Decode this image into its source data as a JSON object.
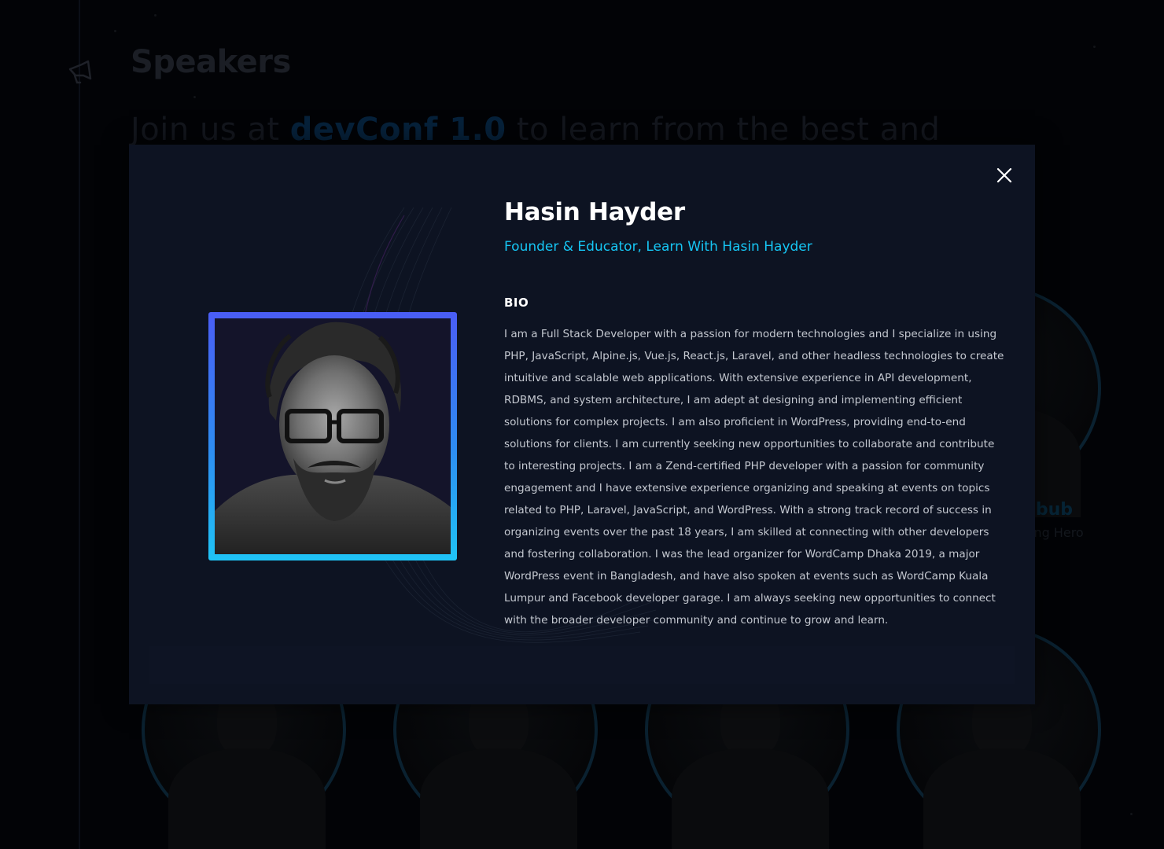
{
  "page": {
    "section_title": "Speakers",
    "headline_prefix": "Join us at ",
    "headline_highlight": "devConf 1.0",
    "headline_suffix": " to learn from the best and",
    "icons": {
      "section": "megaphone-icon",
      "close": "close-icon"
    }
  },
  "background_speaker": {
    "name_fragment": "abub",
    "role_fragment": "ing Hero"
  },
  "modal": {
    "name": "Hasin Hayder",
    "role": "Founder & Educator, Learn With Hasin Hayder",
    "bio_heading": "BIO",
    "bio": "I am a Full Stack Developer with a passion for modern technologies and I specialize in using PHP, JavaScript, Alpine.js, Vue.js, React.js, Laravel, and other headless technologies to create intuitive and scalable web applications. With extensive experience in API development, RDBMS, and system architecture, I am adept at designing and implementing efficient solutions for complex projects. I am also proficient in WordPress, providing end-to-end solutions for clients. I am currently seeking new opportunities to collaborate and contribute to interesting projects. I am a Zend-certified PHP developer with a passion for community engagement and I have extensive experience organizing and speaking at events on topics related to PHP, Laravel, JavaScript, and WordPress. With a strong track record of success in organizing events over the past 18 years, I am skilled at connecting with other developers and fostering collaboration. I was the lead organizer for WordCamp Dhaka 2019, a major WordPress event in Bangladesh, and have also spoken at events such as WordCamp Kuala Lumpur and Facebook developer garage. I am always seeking new opportunities to connect with the broader developer community and continue to grow and learn."
  },
  "colors": {
    "modal_bg": "#0d1322",
    "accent_cyan": "#16c6f4",
    "frame_gradient_top": "#4a5df5",
    "frame_gradient_bottom": "#1fc4f6"
  }
}
